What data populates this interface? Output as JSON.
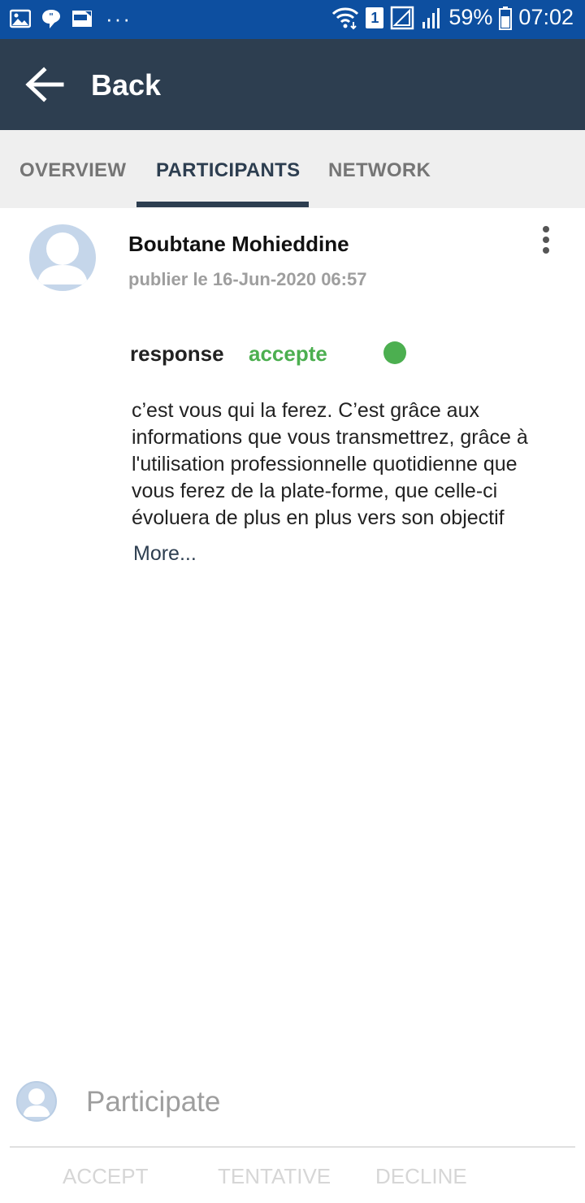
{
  "status_bar": {
    "icons_left": [
      "gallery-icon",
      "chat-bubble-icon",
      "app-notification-icon"
    ],
    "overflow": "···",
    "sim": "1",
    "battery_percent": "59%",
    "time": "07:02"
  },
  "header": {
    "back_label": "Back",
    "background_color": "#2d3e50"
  },
  "tabs": [
    {
      "label": "OVERVIEW",
      "active": false
    },
    {
      "label": "PARTICIPANTS",
      "active": true
    },
    {
      "label": "NETWORK",
      "active": false
    }
  ],
  "post": {
    "author": "Boubtane  Mohieddine",
    "date": "publier le 16-Jun-2020 06:57",
    "response_label": "response",
    "response_value": "accepte",
    "response_color": "#4caf50",
    "body_lines": [
      "c’est vous qui la ferez. C’est grâce aux",
      "informations que vous transmettrez, grâce à",
      "l'utilisation professionnelle quotidienne que",
      "vous ferez de la plate-forme, que celle-ci",
      "évoluera de plus en plus vers son objectif"
    ],
    "more_label": "More..."
  },
  "footer": {
    "participate_placeholder": "Participate",
    "actions": [
      "ACCEPT",
      "TENTATIVE",
      "DECLINE"
    ]
  }
}
